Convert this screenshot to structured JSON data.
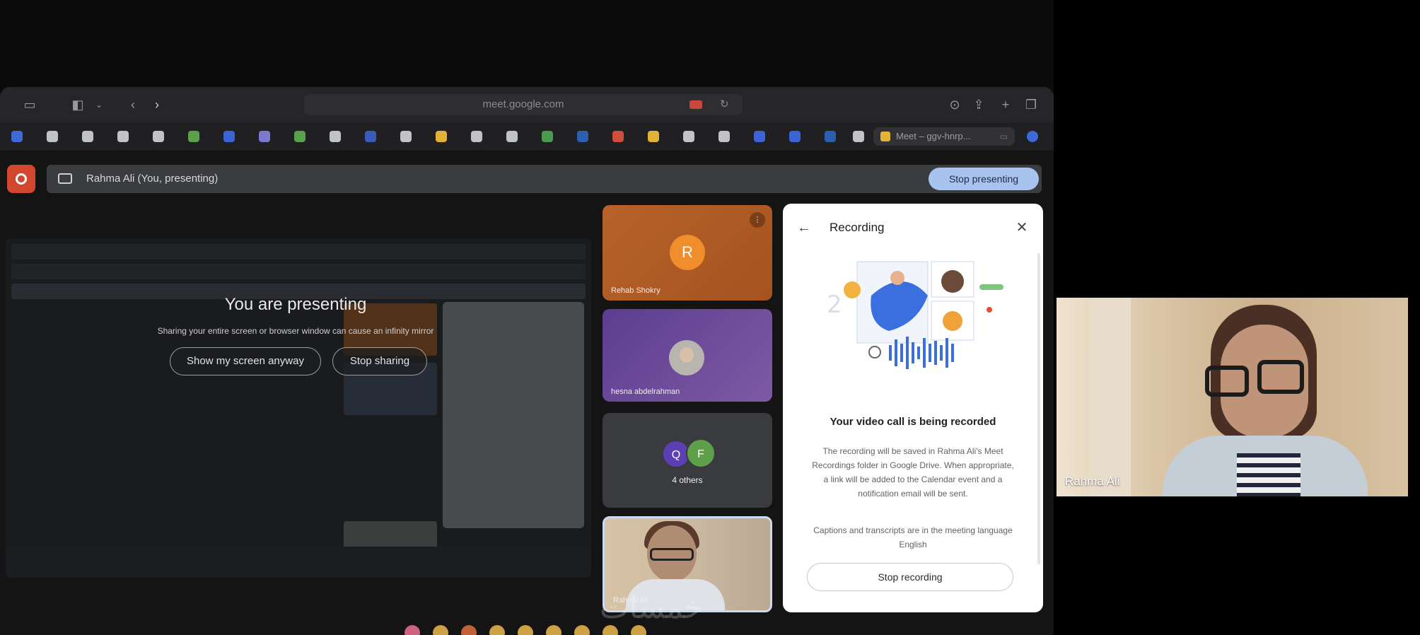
{
  "browser": {
    "url": "meet.google.com",
    "tab_label": "Meet – ggv-hnrp..."
  },
  "meet": {
    "presenting_label": "Rahma Ali (You, presenting)",
    "stop_presenting_label": "Stop presenting",
    "presenting_title": "You are presenting",
    "presenting_subtitle": "Sharing your entire screen or browser window can cause an infinity mirror",
    "show_anyway_label": "Show my screen anyway",
    "stop_sharing_label": "Stop sharing"
  },
  "participants": {
    "tile1_name": "Rehab Shokry",
    "tile1_initial": "R",
    "tile2_name": "hesna abdelrahman",
    "others_initial1": "Q",
    "others_initial2": "F",
    "others_label": "4 others",
    "self_name": "Rahma Ali"
  },
  "recording_panel": {
    "title": "Recording",
    "heading": "Your video call is being recorded",
    "body": "The recording will be saved in Rahma Ali's Meet Recordings folder in Google Drive. When appropriate, a link will be added to the Calendar event and a notification email will be sent.",
    "captions": "Captions and transcripts are in the meeting language English",
    "stop_recording_label": "Stop recording"
  },
  "webcam": {
    "name": "Rahma Ali"
  },
  "watermark": "خمسات",
  "colors": {
    "accent": "#a9c3ef",
    "meet_red": "#d4472f",
    "recording_blue": "#3b6fe0"
  }
}
